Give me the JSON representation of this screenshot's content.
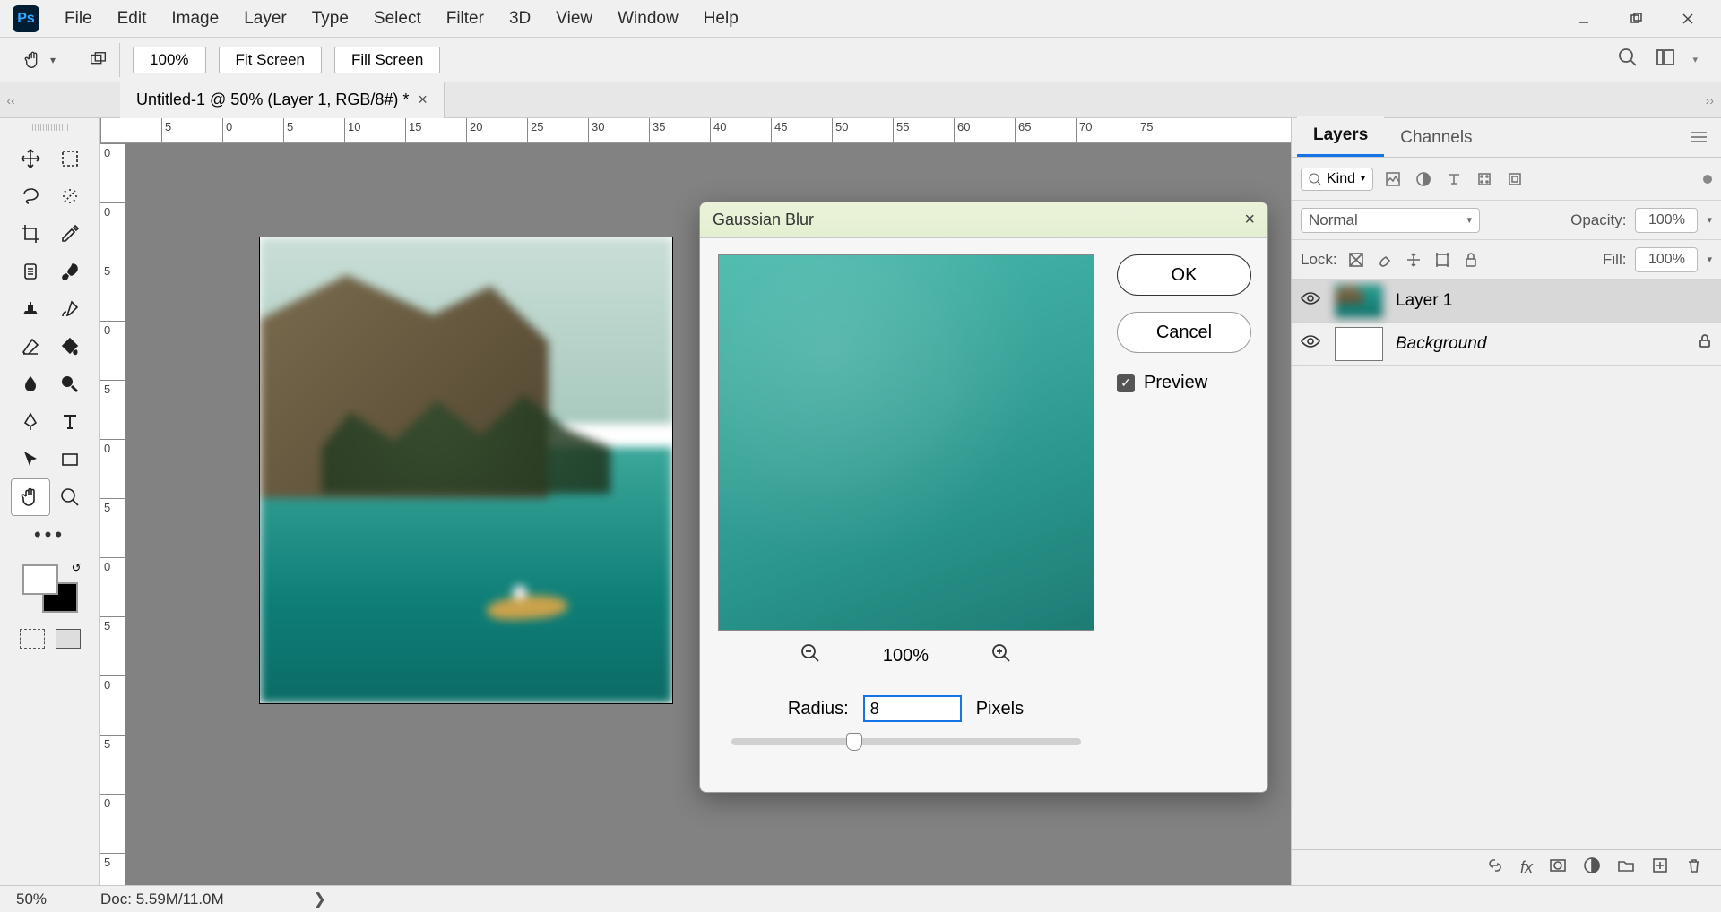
{
  "app": {
    "logo": "Ps"
  },
  "menu": [
    "File",
    "Edit",
    "Image",
    "Layer",
    "Type",
    "Select",
    "Filter",
    "3D",
    "View",
    "Window",
    "Help"
  ],
  "options": {
    "zoom": "100%",
    "fit": "Fit Screen",
    "fill": "Fill Screen"
  },
  "doc": {
    "tab": "Untitled-1 @ 50% (Layer 1, RGB/8#) *"
  },
  "ruler_top": [
    "",
    "5",
    "0",
    "5",
    "10",
    "15",
    "20",
    "25",
    "30",
    "35",
    "40",
    "45",
    "50",
    "55",
    "60",
    "65",
    "70",
    "75"
  ],
  "ruler_left": [
    "0",
    "0",
    "5",
    "0",
    "5",
    "0",
    "5",
    "0",
    "5",
    "0",
    "5",
    "0",
    "5"
  ],
  "status": {
    "zoom": "50%",
    "docinfo": "Doc: 5.59M/11.0M"
  },
  "panel": {
    "tabs": [
      "Layers",
      "Channels"
    ],
    "kind_label": "Kind",
    "blend_mode": "Normal",
    "opacity_label": "Opacity:",
    "opacity_val": "100%",
    "lock_label": "Lock:",
    "fill_label": "Fill:",
    "fill_val": "100%",
    "layers": [
      {
        "name": "Layer 1",
        "locked": false
      },
      {
        "name": "Background",
        "locked": true
      }
    ]
  },
  "dialog": {
    "title": "Gaussian Blur",
    "ok": "OK",
    "cancel": "Cancel",
    "preview": "Preview",
    "zoom": "100%",
    "radius_label": "Radius:",
    "radius_value": "8",
    "radius_unit": "Pixels"
  }
}
